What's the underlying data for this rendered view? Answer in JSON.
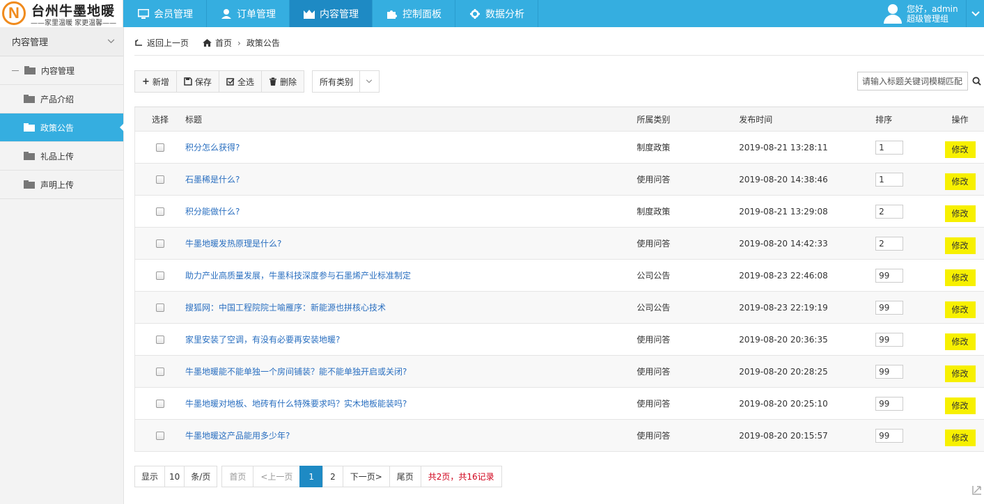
{
  "brand": {
    "title": "台州牛墨地暖",
    "subtitle": "——家里温暖 家更温馨——",
    "logo_letter": "N"
  },
  "topnav": [
    {
      "label": "会员管理",
      "icon": "monitor-icon"
    },
    {
      "label": "订单管理",
      "icon": "user-icon"
    },
    {
      "label": "内容管理",
      "icon": "content-icon",
      "active": true
    },
    {
      "label": "控制面板",
      "icon": "puzzle-icon"
    },
    {
      "label": "数据分析",
      "icon": "gear-icon"
    }
  ],
  "user": {
    "greeting": "您好，admin",
    "role": "超级管理组"
  },
  "sidebar": {
    "header": "内容管理",
    "items": [
      {
        "label": "内容管理",
        "level": 1
      },
      {
        "label": "产品介绍",
        "level": 2
      },
      {
        "label": "政策公告",
        "level": 2,
        "active": true
      },
      {
        "label": "礼品上传",
        "level": 2
      },
      {
        "label": "声明上传",
        "level": 2
      }
    ]
  },
  "breadcrumb": {
    "back": "返回上一页",
    "home": "首页",
    "current": "政策公告"
  },
  "toolbar": {
    "add": "新增",
    "save": "保存",
    "select_all": "全选",
    "delete": "删除",
    "category_select": "所有类别"
  },
  "search": {
    "placeholder": "请输入标题关键词模糊匹配"
  },
  "table": {
    "headers": {
      "select": "选择",
      "title": "标题",
      "category": "所属类别",
      "time": "发布时间",
      "sort": "排序",
      "action": "操作"
    },
    "edit_label": "修改",
    "rows": [
      {
        "title": "积分怎么获得?",
        "category": "制度政策",
        "time": "2019-08-21 13:28:11",
        "sort": "1"
      },
      {
        "title": "石墨稀是什么?",
        "category": "使用问答",
        "time": "2019-08-20 14:38:46",
        "sort": "1"
      },
      {
        "title": "积分能做什么?",
        "category": "制度政策",
        "time": "2019-08-21 13:29:08",
        "sort": "2"
      },
      {
        "title": "牛墨地暖发热原理是什么?",
        "category": "使用问答",
        "time": "2019-08-20 14:42:33",
        "sort": "2"
      },
      {
        "title": "助力产业高质量发展，牛墨科技深度参与石墨烯产业标准制定",
        "category": "公司公告",
        "time": "2019-08-23 22:46:08",
        "sort": "99"
      },
      {
        "title": "搜狐网：中国工程院院士喻雁序：新能源也拼核心技术",
        "category": "公司公告",
        "time": "2019-08-23 22:19:19",
        "sort": "99"
      },
      {
        "title": "家里安装了空调，有没有必要再安装地暖?",
        "category": "使用问答",
        "time": "2019-08-20 20:36:35",
        "sort": "99"
      },
      {
        "title": "牛墨地暖能不能单独一个房间铺装？能不能单独开启或关闭?",
        "category": "使用问答",
        "time": "2019-08-20 20:28:25",
        "sort": "99"
      },
      {
        "title": "牛墨地暖对地板、地砖有什么特殊要求吗？实木地板能装吗?",
        "category": "使用问答",
        "time": "2019-08-20 20:25:10",
        "sort": "99"
      },
      {
        "title": "牛墨地暖这产品能用多少年?",
        "category": "使用问答",
        "time": "2019-08-20 20:15:57",
        "sort": "99"
      }
    ]
  },
  "pagination": {
    "show": "显示",
    "page_size": "10",
    "per_page": "条/页",
    "first": "首页",
    "prev": "<上一页",
    "pages": [
      "1",
      "2"
    ],
    "current": "1",
    "next": "下一页>",
    "last": "尾页",
    "summary": "共2页，共16记录"
  },
  "colors": {
    "topbar": "#35aee0",
    "active": "#1e8ac4",
    "edit_button": "#f7f000",
    "link": "#2a6fc0",
    "summary": "#d0021b"
  }
}
